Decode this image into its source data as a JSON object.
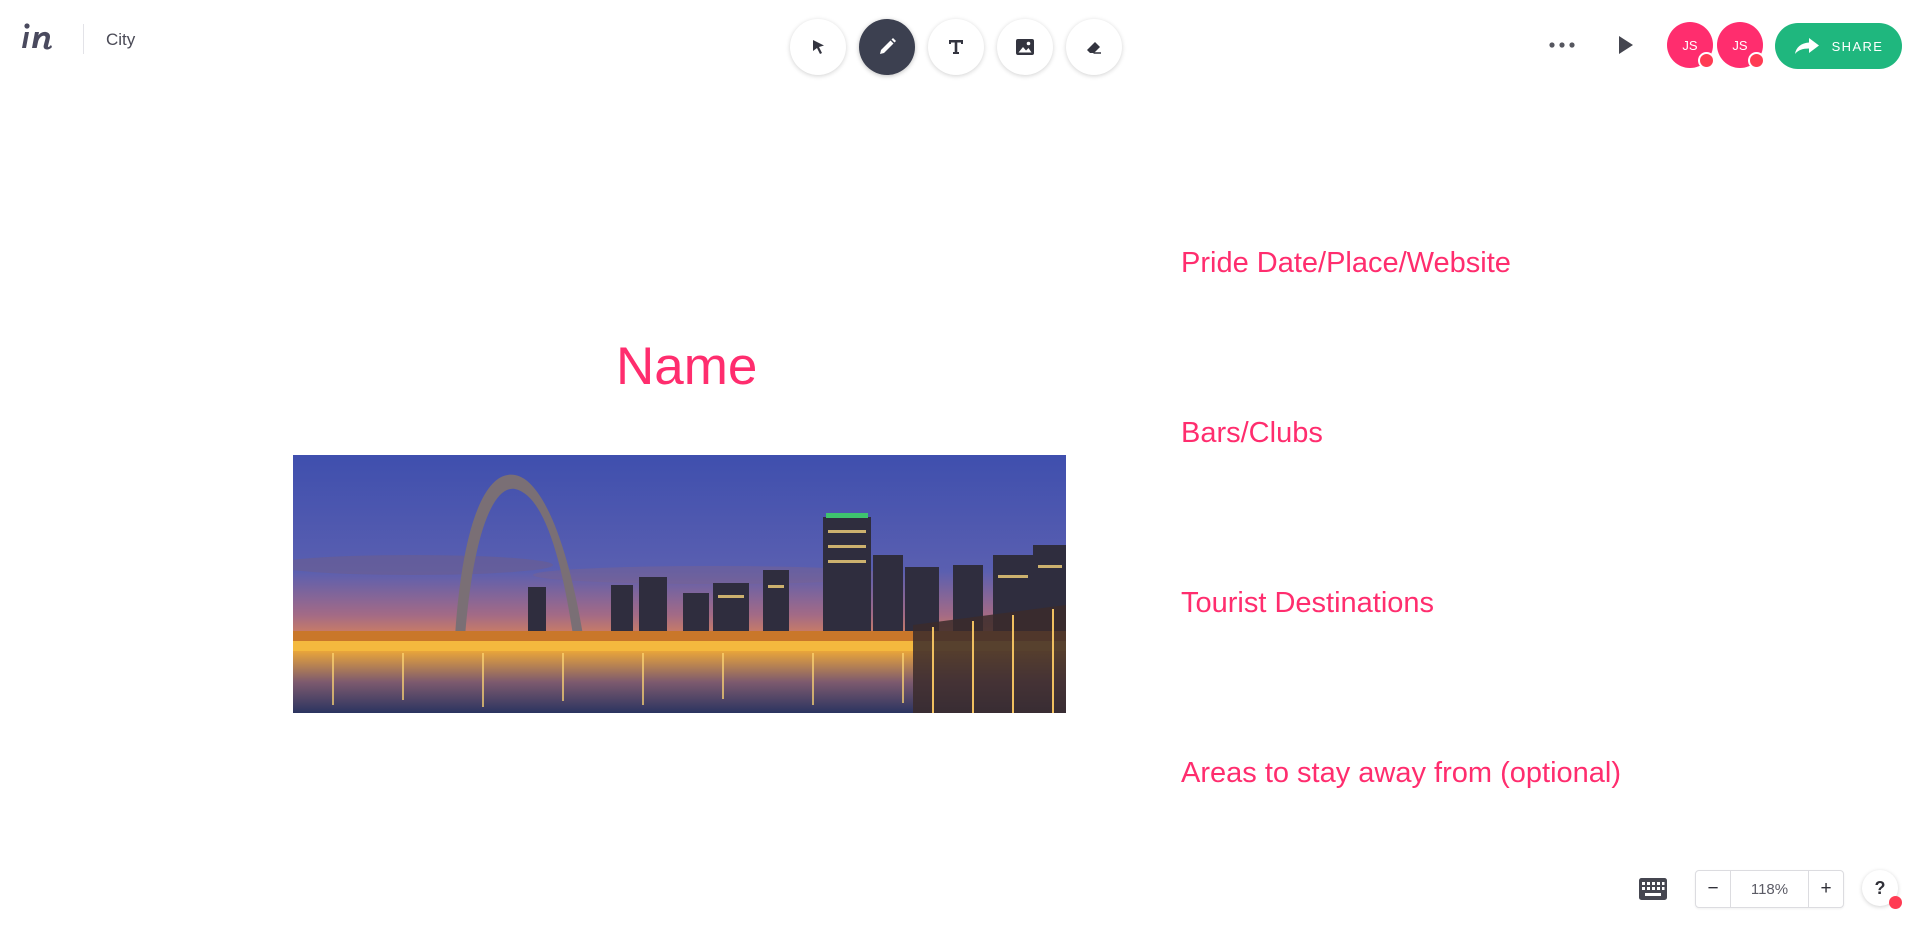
{
  "header": {
    "doc_title": "City",
    "logo_icon": "invision-logo-icon"
  },
  "toolbar": {
    "tools": [
      {
        "name": "select",
        "icon": "cursor-arrow-icon",
        "active": false
      },
      {
        "name": "draw",
        "icon": "pencil-icon",
        "active": true
      },
      {
        "name": "text",
        "icon": "text-t-icon",
        "active": false
      },
      {
        "name": "image",
        "icon": "image-icon",
        "active": false
      },
      {
        "name": "eraser",
        "icon": "eraser-icon",
        "active": false
      }
    ]
  },
  "header_right": {
    "more_icon": "more-dots-icon",
    "play_icon": "play-icon",
    "avatars": [
      "JS",
      "JS"
    ],
    "share_label": "SHARE",
    "share_icon": "share-arrow-icon"
  },
  "canvas": {
    "heading": "Name",
    "image_icon": "city-skyline-image",
    "labels": [
      "Pride Date/Place/Website",
      "Bars/Clubs",
      "Tourist Destinations",
      "Areas to stay away from (optional)"
    ]
  },
  "footer": {
    "keyboard_icon": "keyboard-icon",
    "zoom_out": "−",
    "zoom_level": "118%",
    "zoom_in": "+",
    "help": "?"
  },
  "colors": {
    "accent_pink": "#ff2d6e",
    "share_green": "#1fb77e",
    "active_tool": "#3c4050"
  }
}
